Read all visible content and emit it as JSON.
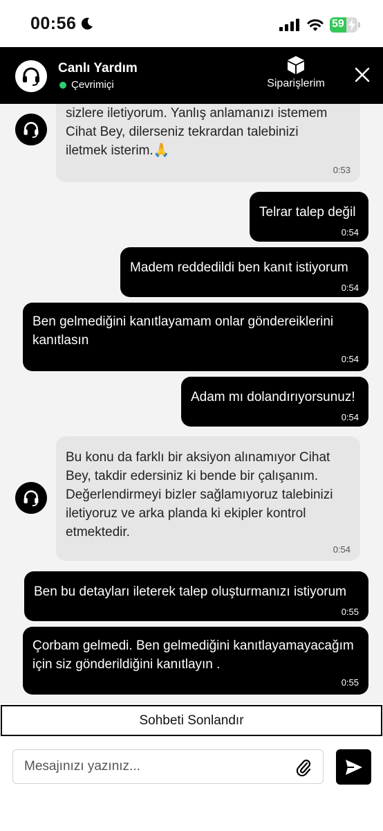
{
  "status_bar": {
    "time": "00:56",
    "battery_percent": "59",
    "battery_level": 0.59,
    "icons": [
      "moon-icon",
      "signal-icon",
      "wifi-icon",
      "battery-icon"
    ]
  },
  "header": {
    "title": "Canlı Yardım",
    "status": "Çevrimiçi",
    "status_color": "#2ecc71",
    "orders_label": "Siparişlerim",
    "icons": [
      "headset-icon",
      "package-icon",
      "close-icon"
    ]
  },
  "messages": [
    {
      "from": "agent",
      "text": "sizlere iletiyorum. Yanlış anlamanızı istemem\nCihat Bey, dilerseniz tekrardan talebinizi\niletmek isterim.🙏",
      "time": "0:53"
    },
    {
      "from": "user",
      "text": "Telrar talep değil",
      "time": "0:54"
    },
    {
      "from": "user",
      "text": "Madem reddedildi ben kanıt istiyorum",
      "time": "0:54"
    },
    {
      "from": "user",
      "text": "Ben gelmediğini kanıtlayamam onlar göndereiklerini\nkanıtlasın",
      "time": "0:54"
    },
    {
      "from": "user",
      "text": "Adam mı dolandırıyorsunuz!",
      "time": "0:54"
    },
    {
      "from": "agent",
      "text": "Bu konu da farklı bir aksiyon alınamıyor Cihat\nBey, takdir edersiniz ki bende bir çalışanım.\nDeğerlendirmeyi bizler sağlamıyoruz talebinizi\niletiyoruz ve arka planda ki ekipler kontrol\netmektedir.",
      "time": "0:54"
    },
    {
      "from": "user",
      "text": "Ben bu detayları ileterek talep oluşturmanızı istiyorum",
      "time": "0:55"
    },
    {
      "from": "user",
      "text": "Çorbam gelmedi. Ben gelmediğini kanıtlayamayacağım\niçin siz gönderildiğini kanıtlayın .",
      "time": "0:55"
    }
  ],
  "end_chat_label": "Sohbeti Sonlandır",
  "composer": {
    "placeholder": "Mesajınızı yazınız...",
    "value": "",
    "icons": [
      "paperclip-icon",
      "send-icon"
    ]
  },
  "colors": {
    "header_bg": "#000000",
    "chat_bg": "#f3f3f3",
    "agent_bubble": "#e6e6e6",
    "user_bubble": "#000000",
    "online": "#2ecc71",
    "battery": "#34c759"
  }
}
